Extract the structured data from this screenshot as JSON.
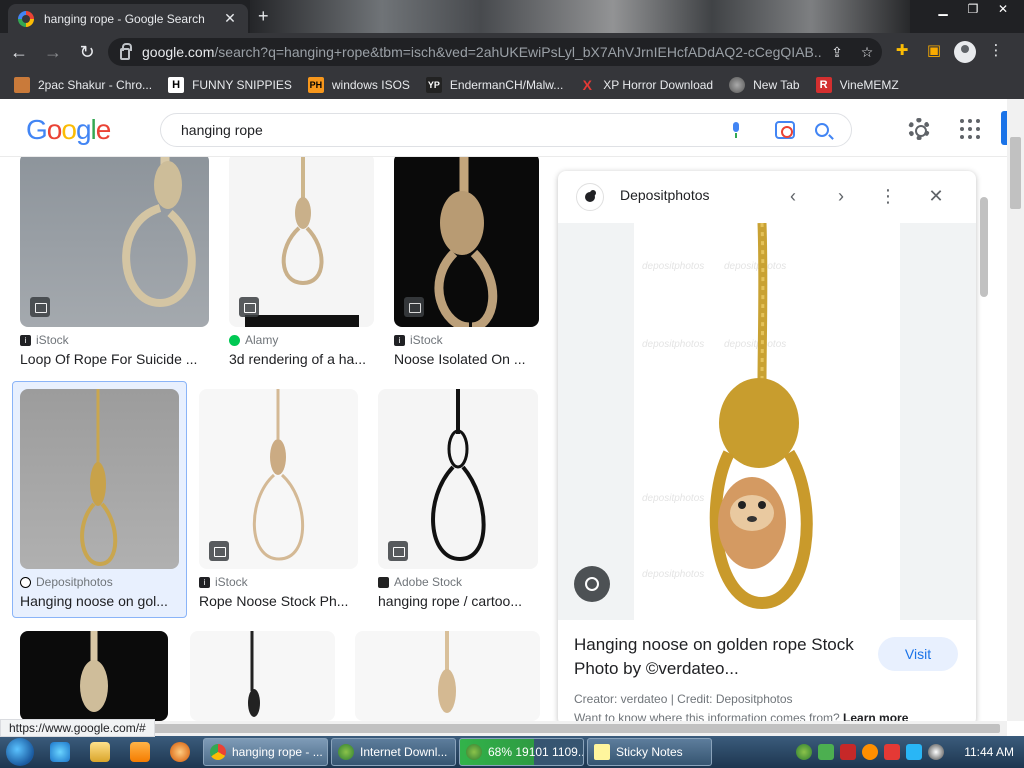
{
  "browser": {
    "tab_title": "hanging rope - Google Search",
    "tab_close": "✕",
    "new_tab": "+",
    "url_domain": "google.com",
    "url_rest": "/search?q=hanging+rope&tbm=isch&ved=2ahUKEwiPsLyl_bX7AhVJrnIEHcfADdAQ2-cCegQIAB...",
    "bookmarks": [
      {
        "label": "2pac Shakur - Chro...",
        "icon": "bookmark-icon"
      },
      {
        "label": "FUNNY SNIPPIES",
        "icon": "H"
      },
      {
        "label": "windows ISOS",
        "icon": "PH"
      },
      {
        "label": "EndermanCH/Malw...",
        "icon": "YP"
      },
      {
        "label": "XP Horror Download",
        "icon": "X"
      },
      {
        "label": "New Tab",
        "icon": "globe-icon"
      },
      {
        "label": "VineMEMZ",
        "icon": "R"
      }
    ]
  },
  "google": {
    "logo": [
      "G",
      "o",
      "o",
      "g",
      "l",
      "e"
    ],
    "query": "hanging rope"
  },
  "results": [
    {
      "source": "iStock",
      "caption": "Loop Of Rope For Suicide ..."
    },
    {
      "source": "Alamy",
      "caption": "3d rendering of a ha..."
    },
    {
      "source": "iStock",
      "caption": "Noose Isolated On ..."
    },
    {
      "source": "Depositphotos",
      "caption": "Hanging noose on gol..."
    },
    {
      "source": "iStock",
      "caption": "Rope Noose Stock Ph..."
    },
    {
      "source": "Adobe Stock",
      "caption": "hanging rope / cartoo..."
    }
  ],
  "panel": {
    "source": "Depositphotos",
    "title": "Hanging noose on golden rope Stock Photo by ©verdateo...",
    "visit": "Visit",
    "credit": "Creator: verdateo | Credit: Depositphotos",
    "why": "Want to know where this information comes from?",
    "learn_more": "Learn more",
    "watermark": "depositphotos"
  },
  "status_url": "https://www.google.com/#",
  "taskbar": {
    "items": [
      {
        "label": "hanging rope - ..."
      },
      {
        "label": "Internet Downl..."
      },
      {
        "label": "68% 19101 1109..."
      },
      {
        "label": "Sticky Notes"
      }
    ],
    "clock": "11:44 AM"
  },
  "colors": {
    "accent": "#1a73e8",
    "chrome_dark": "#35363a"
  }
}
